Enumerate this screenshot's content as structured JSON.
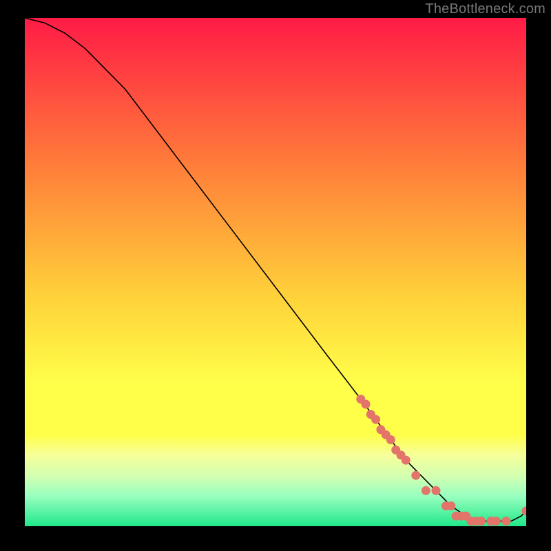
{
  "watermark": "TheBottleneck.com",
  "colors": {
    "top": "#ff1b46",
    "mid1": "#ff7a3a",
    "mid2": "#ffd23a",
    "mid3": "#ffff4a",
    "band1": "#f6ff9a",
    "band2": "#d4ffb0",
    "band3": "#9affc0",
    "bottom": "#20e88a",
    "curve": "#000000",
    "dot": "#e2746a"
  },
  "chart_data": {
    "type": "line",
    "title": "",
    "xlabel": "",
    "ylabel": "",
    "xlim": [
      0,
      100
    ],
    "ylim": [
      0,
      100
    ],
    "series": [
      {
        "name": "bottleneck-curve",
        "x": [
          0,
          4,
          8,
          12,
          20,
          30,
          40,
          50,
          60,
          67,
          70,
          73,
          76,
          79,
          82,
          85,
          88,
          91,
          93,
          95,
          97,
          99,
          100
        ],
        "values": [
          100,
          99,
          97,
          94,
          86,
          73,
          60,
          47,
          34,
          25,
          21,
          17,
          13,
          10,
          7,
          4,
          2,
          1,
          1,
          1,
          1,
          2,
          3
        ]
      }
    ],
    "dots": {
      "name": "sample-points",
      "x": [
        67,
        68,
        69,
        70,
        71,
        72,
        73,
        74,
        75,
        76,
        78,
        80,
        82,
        84,
        85,
        86,
        87,
        88,
        89,
        90,
        91,
        93,
        94,
        96,
        100
      ],
      "values": [
        25,
        24,
        22,
        21,
        19,
        18,
        17,
        15,
        14,
        13,
        10,
        7,
        7,
        4,
        4,
        2,
        2,
        2,
        1,
        1,
        1,
        1,
        1,
        1,
        3
      ]
    },
    "gradient_stops": [
      {
        "pos": 0.0,
        "key": "top"
      },
      {
        "pos": 0.28,
        "key": "mid1"
      },
      {
        "pos": 0.55,
        "key": "mid2"
      },
      {
        "pos": 0.72,
        "key": "mid3"
      },
      {
        "pos": 0.82,
        "key": "mid3"
      },
      {
        "pos": 0.86,
        "key": "band1"
      },
      {
        "pos": 0.9,
        "key": "band2"
      },
      {
        "pos": 0.94,
        "key": "band3"
      },
      {
        "pos": 1.0,
        "key": "bottom"
      }
    ]
  }
}
